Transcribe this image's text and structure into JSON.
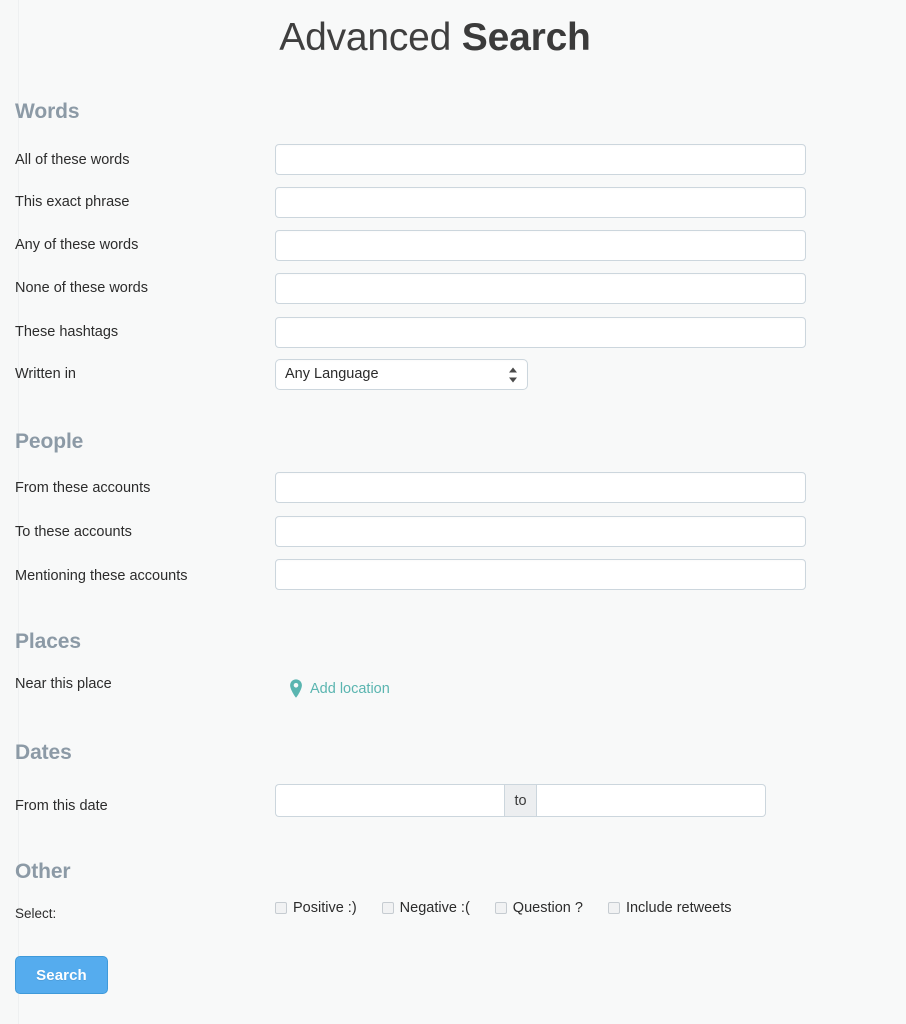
{
  "header": {
    "title_light": "Advanced ",
    "title_bold": "Search"
  },
  "colors": {
    "page_background": "#f7f8f8",
    "section_heading": "#8c9aa6",
    "label_text": "#2c2c2c",
    "input_border": "#ccd6dd",
    "link_teal": "#5ab5b0",
    "button_blue": "#55acee",
    "separator_fill": "#eceef0"
  },
  "sections": {
    "words": {
      "heading": "Words",
      "fields": [
        {
          "label": "All of these words",
          "value": "",
          "placeholder": ""
        },
        {
          "label": "This exact phrase",
          "value": "",
          "placeholder": ""
        },
        {
          "label": "Any of these words",
          "value": "",
          "placeholder": ""
        },
        {
          "label": "None of these words",
          "value": "",
          "placeholder": ""
        },
        {
          "label": "These hashtags",
          "value": "",
          "placeholder": ""
        }
      ],
      "language": {
        "label": "Written in",
        "selected": "Any Language",
        "options": [
          "Any Language"
        ]
      }
    },
    "people": {
      "heading": "People",
      "fields": [
        {
          "label": "From these accounts",
          "value": "",
          "placeholder": ""
        },
        {
          "label": "To these accounts",
          "value": "",
          "placeholder": ""
        },
        {
          "label": "Mentioning these accounts",
          "value": "",
          "placeholder": ""
        }
      ]
    },
    "places": {
      "heading": "Places",
      "label": "Near this place",
      "link_text": "Add location",
      "link_icon": "map-pin-icon"
    },
    "dates": {
      "heading": "Dates",
      "label": "From this date",
      "from_value": "",
      "from_placeholder": "",
      "separator": "to",
      "to_value": "",
      "to_placeholder": ""
    },
    "other": {
      "heading": "Other",
      "label": "Select:",
      "checkboxes": [
        {
          "label": "Positive :)",
          "checked": false
        },
        {
          "label": "Negative :(",
          "checked": false
        },
        {
          "label": "Question ?",
          "checked": false
        },
        {
          "label": "Include retweets",
          "checked": false
        }
      ]
    }
  },
  "submit": {
    "label": "Search"
  }
}
